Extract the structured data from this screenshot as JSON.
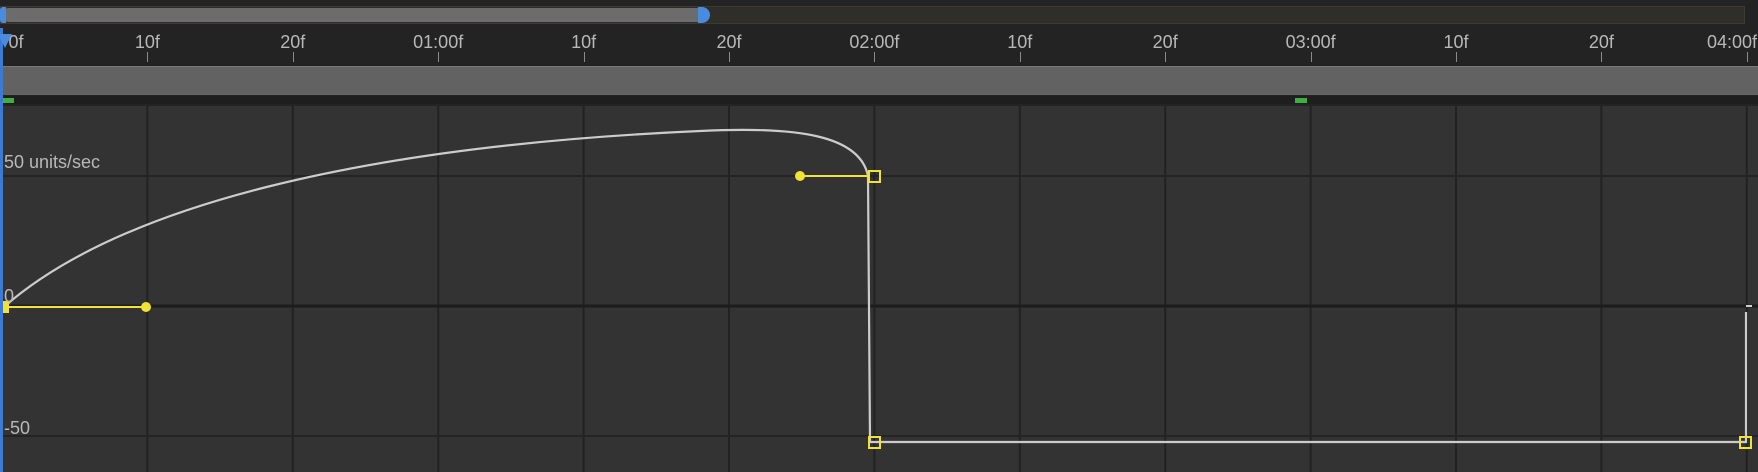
{
  "ruler": {
    "labels": [
      "0f",
      "10f",
      "20f",
      "01:00f",
      "10f",
      "20f",
      "02:00f",
      "10f",
      "20f",
      "03:00f",
      "10f",
      "20f",
      "04:00f"
    ]
  },
  "graph": {
    "value_axis_labels": {
      "top": "50 units/sec",
      "middle": "0",
      "bottom": "-50"
    },
    "units": "units/sec"
  },
  "colors": {
    "background": "#232323",
    "graph_bg": "#333333",
    "curve": "#cccccc",
    "keyframe": "#f2e238",
    "playhead": "#3d7bd3",
    "marker": "#3fb03f"
  }
}
